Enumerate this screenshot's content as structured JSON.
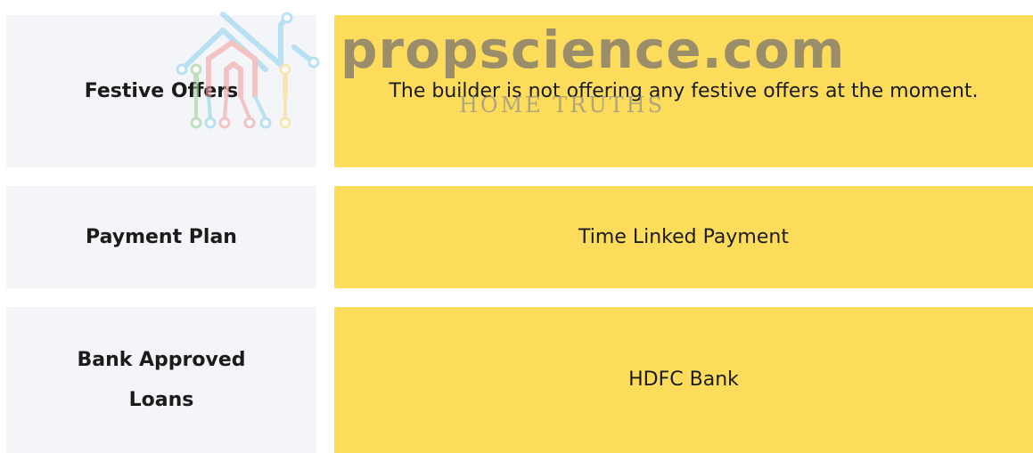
{
  "rows": [
    {
      "label": "Festive Offers",
      "value": "The builder is not offering any festive offers at the moment."
    },
    {
      "label": "Payment Plan",
      "value": "Time Linked Payment"
    },
    {
      "label": "Bank Approved Loans",
      "value": "HDFC Bank"
    }
  ],
  "watermark": {
    "brand": "propscience.com",
    "tagline": "HOME TRUTHS",
    "icon": "house-circuit-logo"
  },
  "colors": {
    "label_bg": "#f4f5f8",
    "value_bg": "#fedc5b",
    "text": "#1b1b1b"
  }
}
